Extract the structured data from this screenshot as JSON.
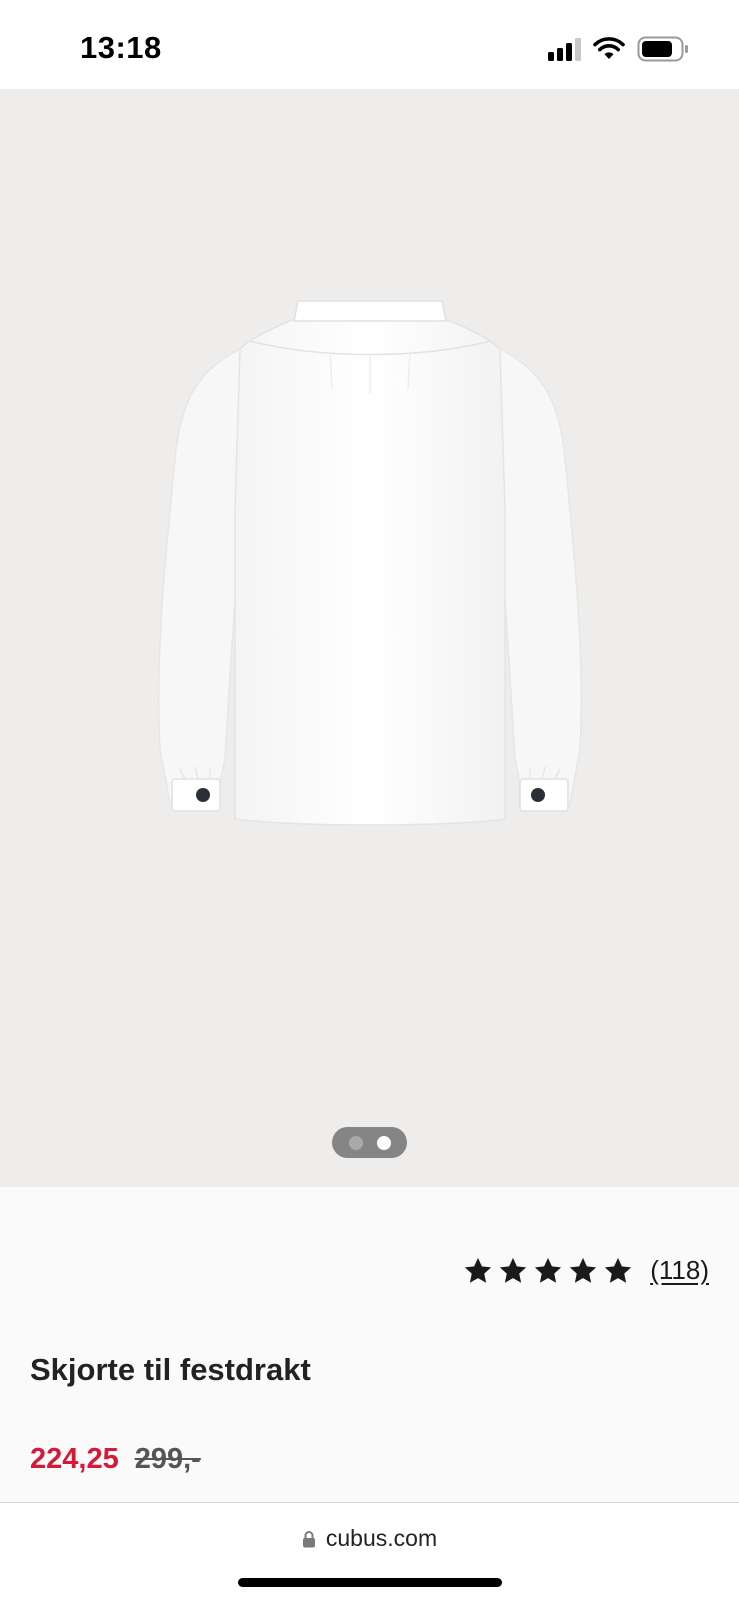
{
  "status_bar": {
    "time": "13:18",
    "icons": [
      "cellular-signal-icon",
      "wifi-icon",
      "battery-icon"
    ]
  },
  "gallery": {
    "image": "white-shirt-back-view",
    "page_count": 2,
    "active_page": 2
  },
  "product": {
    "rating": {
      "stars": 5,
      "count_label": "(118)"
    },
    "title": "Skjorte til festdrakt",
    "price_current": "224,25",
    "price_old": "299,-",
    "colors": {
      "sale_price": "#d31a3a",
      "old_price": "#555555"
    }
  },
  "browser": {
    "url": "cubus.com",
    "lock_icon": "lock-icon"
  }
}
